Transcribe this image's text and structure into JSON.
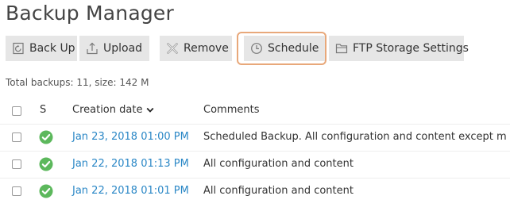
{
  "page": {
    "title": "Backup Manager"
  },
  "toolbar": {
    "backup_label": "Back Up",
    "upload_label": "Upload",
    "remove_label": "Remove",
    "schedule_label": "Schedule",
    "ftp_label": "FTP Storage Settings"
  },
  "summary": "Total backups: 11, size: 142 M",
  "table": {
    "columns": {
      "status": "S",
      "date": "Creation date",
      "comments": "Comments"
    },
    "rows": [
      {
        "date": "Jan 23, 2018 01:00 PM",
        "comment": "Scheduled Backup. All configuration and content except m",
        "status": "ok"
      },
      {
        "date": "Jan 22, 2018 01:13 PM",
        "comment": "All configuration and content",
        "status": "ok"
      },
      {
        "date": "Jan 22, 2018 01:01 PM",
        "comment": "All configuration and content",
        "status": "ok"
      }
    ]
  },
  "colors": {
    "status_ok": "#5cb85c",
    "link": "#2a87c6",
    "highlight": "#e8a87a"
  },
  "icons": {
    "backup": "backup-icon",
    "upload": "upload-icon",
    "remove": "remove-icon",
    "schedule": "clock-icon",
    "ftp": "folder-icon",
    "sort": "chevron-down-icon",
    "status_ok": "check-circle-icon"
  }
}
